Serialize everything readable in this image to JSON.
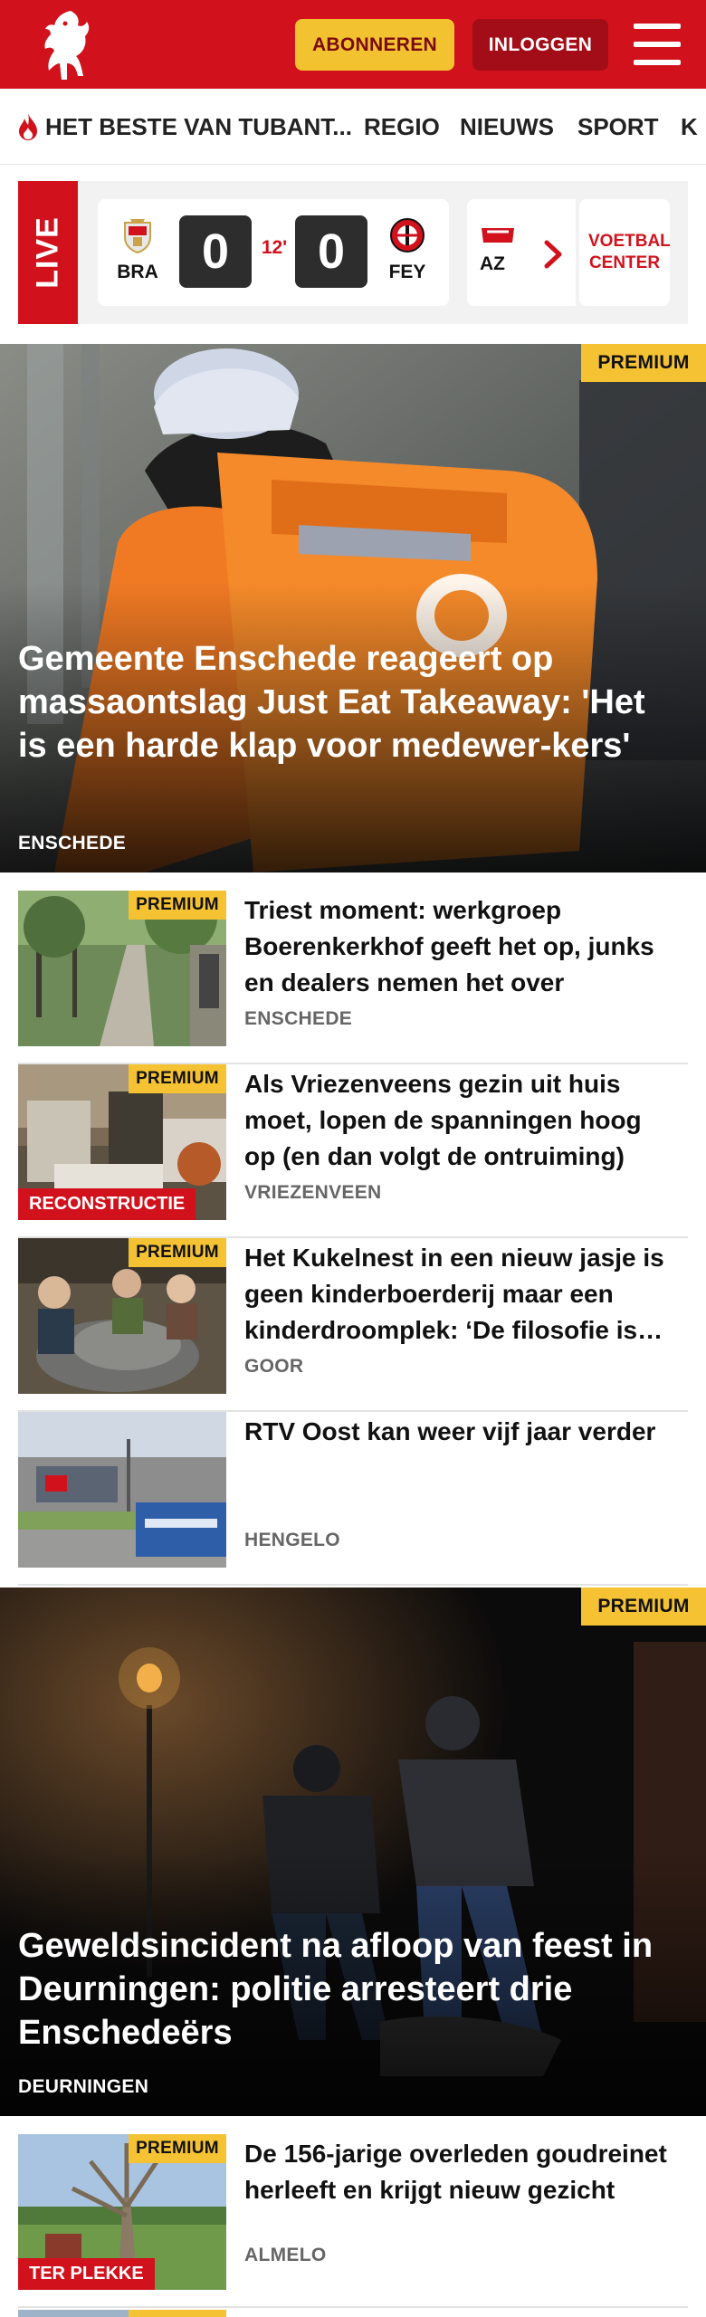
{
  "header": {
    "subscribe_label": "ABONNEREN",
    "login_label": "INLOGGEN",
    "brand_color": "#d1121d"
  },
  "nav": {
    "items": [
      {
        "label": "HET BESTE VAN TUBANT...",
        "icon": "flame-icon"
      },
      {
        "label": "REGIO"
      },
      {
        "label": "NIEUWS"
      },
      {
        "label": "SPORT"
      },
      {
        "label": "K"
      }
    ]
  },
  "live": {
    "label": "LIVE",
    "match": {
      "home_abbr": "BRA",
      "home_score": "0",
      "minute": "12'",
      "away_score": "0",
      "away_abbr": "FEY"
    },
    "next_match_abbr": "AZ",
    "voetbal_center_label": "VOETBAL CENTER"
  },
  "hero1": {
    "badge": "PREMIUM",
    "title": "Gemeente Enschede reageert op massaontslag Just Eat Takeaway: 'Het is een harde klap voor medewer-kers'",
    "location": "ENSCHEDE"
  },
  "articles": [
    {
      "badge": "PREMIUM",
      "title": "Triest moment: werkgroep Boerenkerkhof geeft het op, junks en dealers nemen het over",
      "location": "ENSCHEDE"
    },
    {
      "badge": "PREMIUM",
      "tag": "RECONSTRUCTIE",
      "title": "Als Vriezenveens gezin uit huis moet, lopen de spanningen hoog op (en dan volgt de ontruiming)",
      "location": "VRIEZENVEEN"
    },
    {
      "badge": "PREMIUM",
      "title": "Het Kukelnest in een nieuw jasje is geen kinderboerderij maar een kinderdroomplek: ‘De filosofie is eenvoudig’",
      "location": "GOOR"
    },
    {
      "title": "RTV Oost kan weer vijf jaar verder",
      "location": "HENGELO"
    }
  ],
  "hero2": {
    "badge": "PREMIUM",
    "title": "Geweldsincident na afloop van feest in Deurningen: politie arresteert drie Enschedeërs",
    "location": "DEURNINGEN"
  },
  "articles2": [
    {
      "badge": "PREMIUM",
      "tag": "TER PLEKKE",
      "title": "De 156-jarige overleden goudreinet herleeft en krijgt nieuw gezicht",
      "location": "ALMELO"
    }
  ],
  "footer_peek": {
    "badge": "PREMIUM"
  }
}
